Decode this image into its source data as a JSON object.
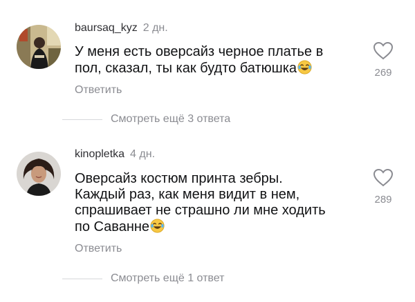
{
  "comments": [
    {
      "username": "baursaq_kyz",
      "time": "2 дн.",
      "text_lines": [
        "У меня есть оверсайз черное платье в",
        "пол, сказал, ты как будто батюшка"
      ],
      "emoji": "laughing-tears-emoji",
      "like_count": "269",
      "reply_label": "Ответить",
      "more_replies": "Смотреть ещё 3 ответа"
    },
    {
      "username": "kinopletka",
      "time": "4 дн.",
      "text_lines": [
        "Оверсайз костюм принта зебры.",
        "Каждый раз, как меня видит в нем,",
        "спрашивает не страшно ли мне ходить",
        "по Саванне"
      ],
      "emoji": "laughing-tears-emoji",
      "like_count": "289",
      "reply_label": "Ответить",
      "more_replies": "Смотреть ещё 1 ответ"
    }
  ],
  "icons": {
    "like": "heart-outline-icon"
  },
  "colors": {
    "text_primary": "#111214",
    "text_secondary": "#8a8b91",
    "divider": "#d6d7da"
  }
}
